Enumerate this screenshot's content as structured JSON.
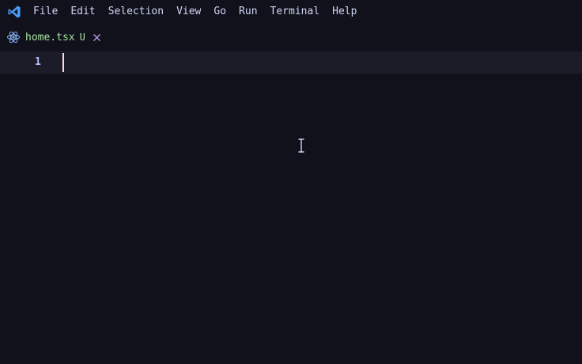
{
  "app": {
    "logo_icon": "vscode-logo-icon"
  },
  "menu": {
    "items": [
      {
        "label": "File"
      },
      {
        "label": "Edit"
      },
      {
        "label": "Selection"
      },
      {
        "label": "View"
      },
      {
        "label": "Go"
      },
      {
        "label": "Run"
      },
      {
        "label": "Terminal"
      },
      {
        "label": "Help"
      }
    ]
  },
  "tabs": [
    {
      "label": "home.tsx",
      "status": "U",
      "icon": "react-icon",
      "close_icon": "close-icon"
    }
  ],
  "editor": {
    "line_numbers": [
      "1"
    ]
  },
  "colors": {
    "background": "#11111b",
    "current_line": "#1c1c28",
    "menu_text": "#cdd6f4",
    "tab_text": "#a6e3a1",
    "line_number": "#b4befe",
    "close_icon": "#cba6f7",
    "react_icon": "#89b4fa",
    "cursor": "#f5e0dc"
  }
}
